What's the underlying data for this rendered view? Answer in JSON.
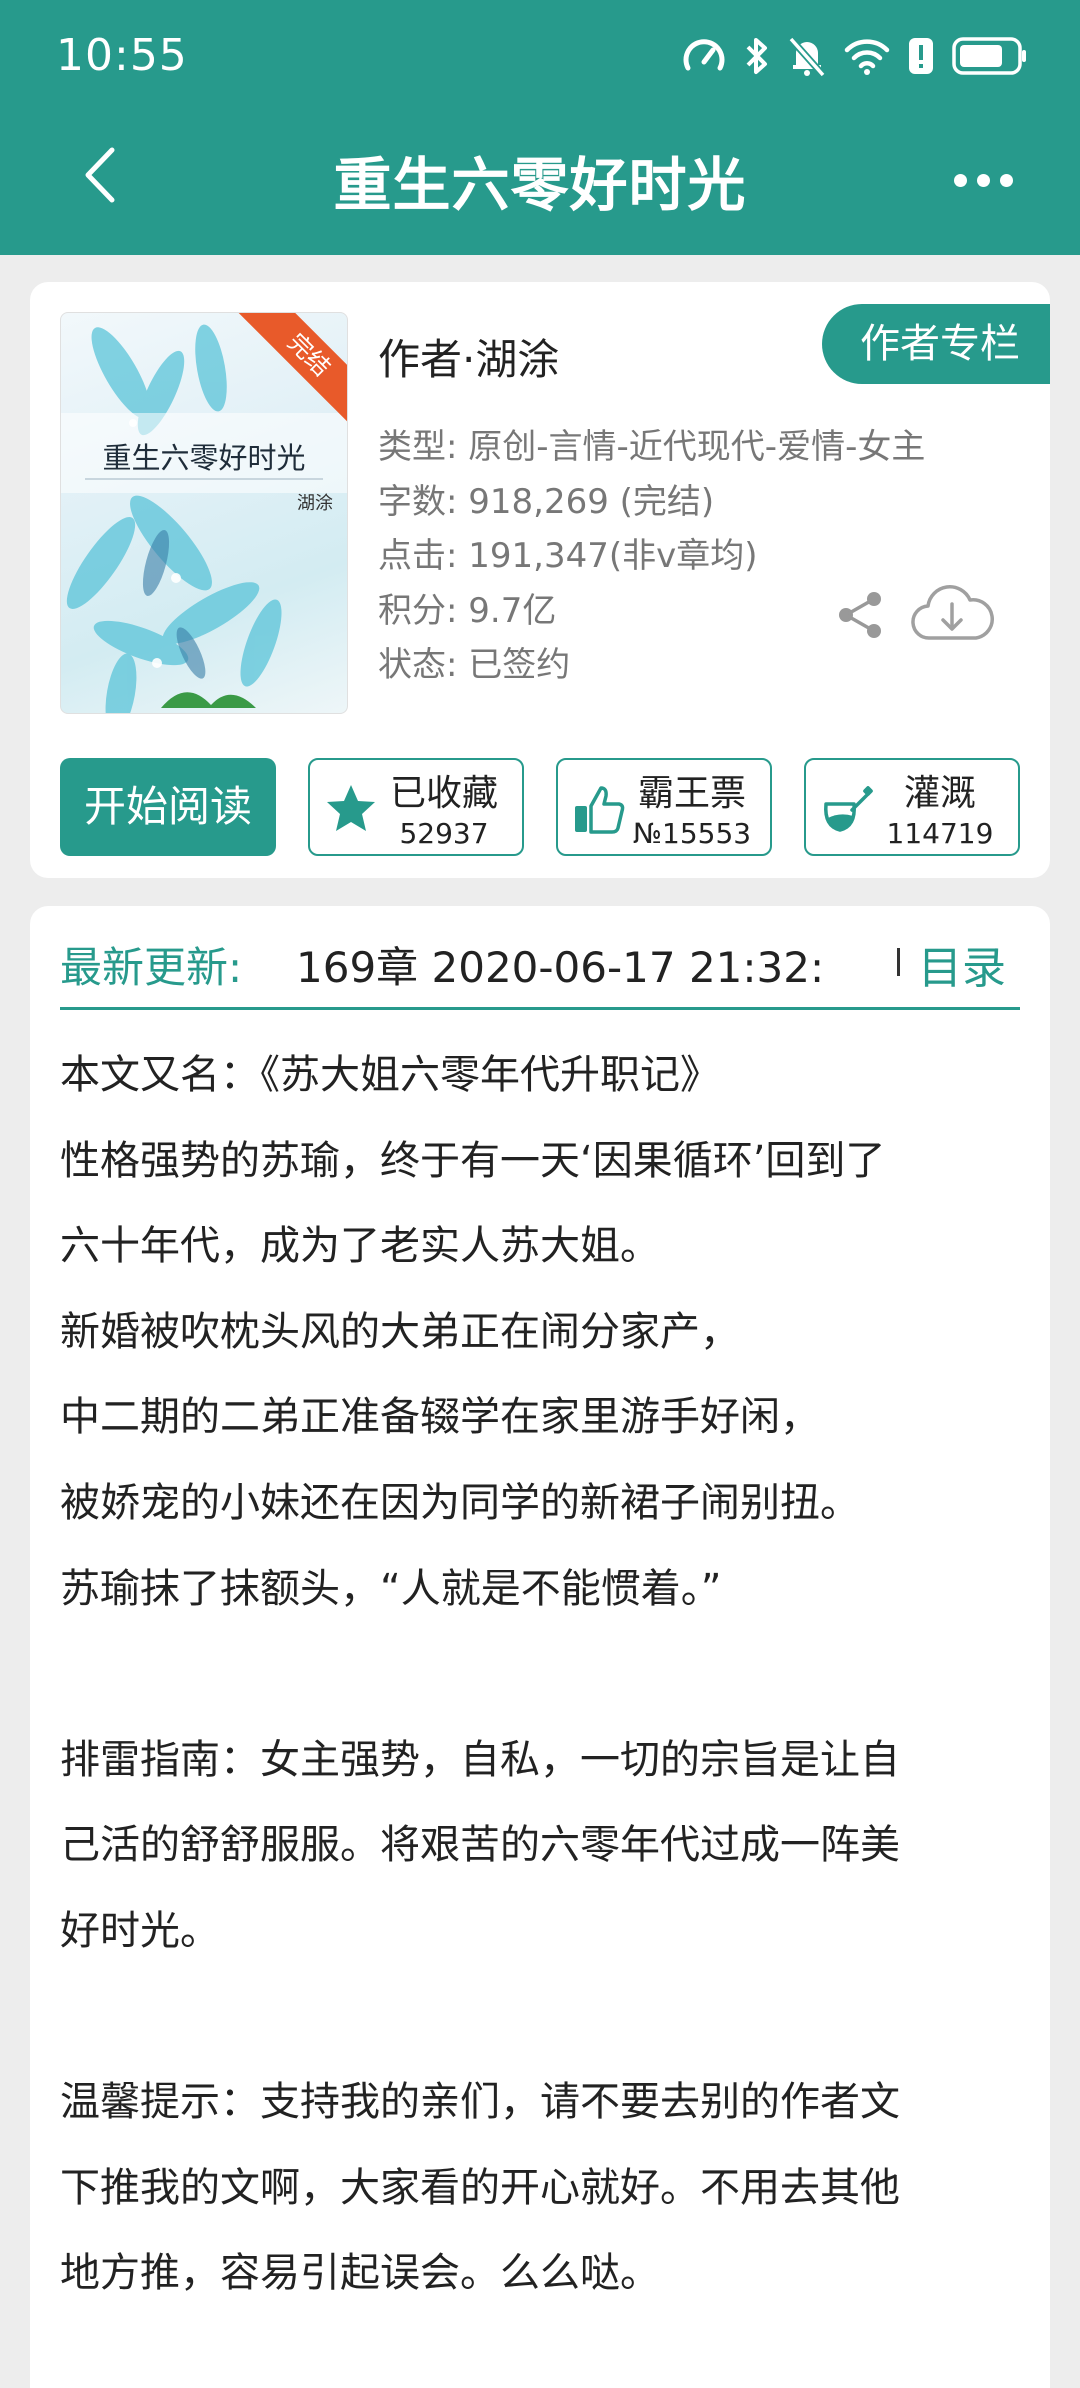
{
  "status_bar": {
    "time": "10:55"
  },
  "header": {
    "title": "重生六零好时光"
  },
  "book": {
    "cover": {
      "title": "重生六零好时光",
      "author": "湖涂",
      "ribbon": "完结"
    },
    "author_line": "作者·湖涂",
    "author_column_label": "作者专栏",
    "meta": {
      "genre": "类型: 原创-言情-近代现代-爱情-女主",
      "word_count": "字数: 918,269 (完结)",
      "clicks": "点击: 191,347(非v章均)",
      "points": "积分: 9.7亿",
      "status": "状态: 已签约"
    }
  },
  "actions": {
    "read_label": "开始阅读",
    "collect": {
      "label": "已收藏",
      "count": "52937"
    },
    "vote": {
      "label": "霸王票",
      "count": "№15553"
    },
    "water": {
      "label": "灌溉",
      "count": "114719"
    }
  },
  "update": {
    "label": "最新更新:",
    "value": "169章  2020-06-17 21:32:",
    "toc_label": "目录"
  },
  "synopsis": [
    "本文又名：《苏大姐六零年代升职记》",
    "性格强势的苏瑜，终于有一天‘因果循环’回到了",
    "六十年代，成为了老实人苏大姐。",
    "新婚被吹枕头风的大弟正在闹分家产，",
    "中二期的二弟正准备辍学在家里游手好闲，",
    "被娇宠的小妹还在因为同学的新裙子闹别扭。",
    "苏瑜抹了抹额头，“人就是不能惯着。”",
    "",
    "排雷指南：女主强势，自私，一切的宗旨是让自",
    "己活的舒舒服服。将艰苦的六零年代过成一阵美",
    "好时光。",
    "",
    "温馨提示：支持我的亲们，请不要去别的作者文",
    "下推我的文啊，大家看的开心就好。不用去其他",
    "地方推，容易引起误会。么么哒。"
  ],
  "colors": {
    "accent": "#279a8c",
    "background": "#ededed",
    "ribbon": "#e85a2a"
  },
  "icons": [
    "speedometer-icon",
    "bluetooth-icon",
    "mute-icon",
    "wifi-icon",
    "alert-icon",
    "battery-icon",
    "back-icon",
    "more-icon",
    "share-icon",
    "download-icon",
    "star-icon",
    "thumbs-up-icon",
    "watering-can-icon"
  ]
}
